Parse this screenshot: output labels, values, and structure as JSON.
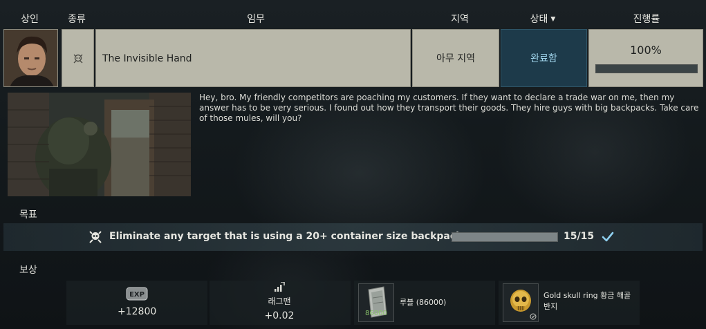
{
  "header": {
    "trader": "상인",
    "type": "종류",
    "task": "임무",
    "location": "지역",
    "status": "상태",
    "progress": "진행률"
  },
  "quest": {
    "name": "The Invisible Hand",
    "location": "아무 지역",
    "status": "완료함",
    "progress_text": "100%",
    "progress_fraction": 1.0,
    "type_icon": "skull-icon"
  },
  "description": "Hey, bro. My friendly competitors are poaching my customers. If they want to declare a trade war on me, then my answer has to be very serious. I found out how they transport their goods. They hire guys with big backpacks. Take care of those mules, will you?",
  "objectives_title": "목표",
  "objective": {
    "text": "Eliminate any target that is using a 20+ container size backpack",
    "count": "15/15",
    "progress_fraction": 1.0
  },
  "rewards_title": "보상",
  "rewards": {
    "exp_badge": "EXP",
    "exp_value": "+12800",
    "rep_name": "래그맨",
    "rep_value": "+0.02",
    "money_label": "루블 (86000)",
    "money_count": "86000",
    "item_label_line1": "Gold skull ring 황금 해골",
    "item_label_line2": "반지"
  },
  "colors": {
    "status_bg": "#1d3a4a",
    "status_text": "#9fd3ea",
    "row_bg": "#b9b8aa",
    "check": "#8fd0f0"
  }
}
